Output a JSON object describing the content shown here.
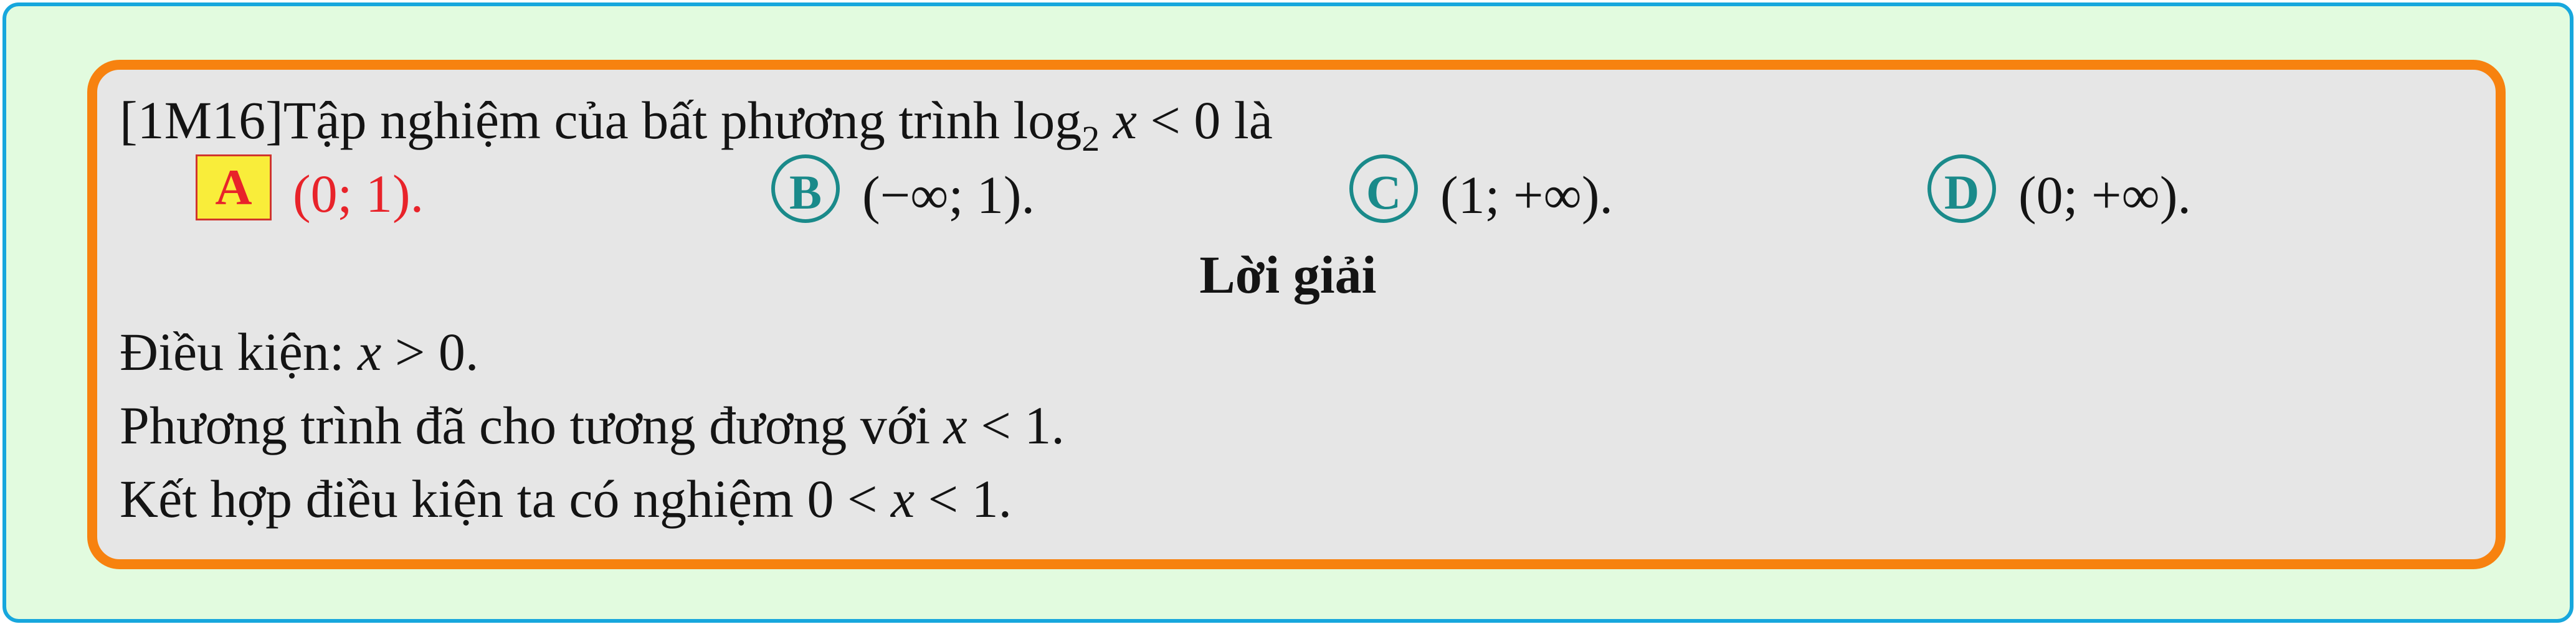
{
  "question": {
    "prefix": "[1M16]Tập nghiệm của bất phương trình ",
    "log": "log",
    "log_base": "2",
    "var": "x",
    "rest": " < 0 là"
  },
  "options": [
    {
      "letter": "A",
      "text": "(0; 1).",
      "correct": true
    },
    {
      "letter": "B",
      "text": "(−∞; 1).",
      "correct": false
    },
    {
      "letter": "C",
      "text": "(1; +∞).",
      "correct": false
    },
    {
      "letter": "D",
      "text": "(0; +∞).",
      "correct": false
    }
  ],
  "solution": {
    "heading": "Lời giải",
    "line1_text": "Điều kiện: ",
    "line1_var": "x",
    "line1_rest": " > 0.",
    "line2_text": "Phương trình đã cho tương đương với ",
    "line2_var": "x",
    "line2_rest": " < 1.",
    "line3_text": "Kết hợp điều kiện ta có nghiệm 0 < ",
    "line3_var": "x",
    "line3_rest": " < 1."
  },
  "colors": {
    "outer_bg": "#e2fbdf",
    "outer_border": "#17a7dd",
    "inner_bg": "#e6e6e6",
    "inner_border": "#f7820f",
    "correct_text": "#e8232a",
    "correct_badge_bg": "#f9ed3a",
    "option_circle": "#1a8a8a"
  }
}
